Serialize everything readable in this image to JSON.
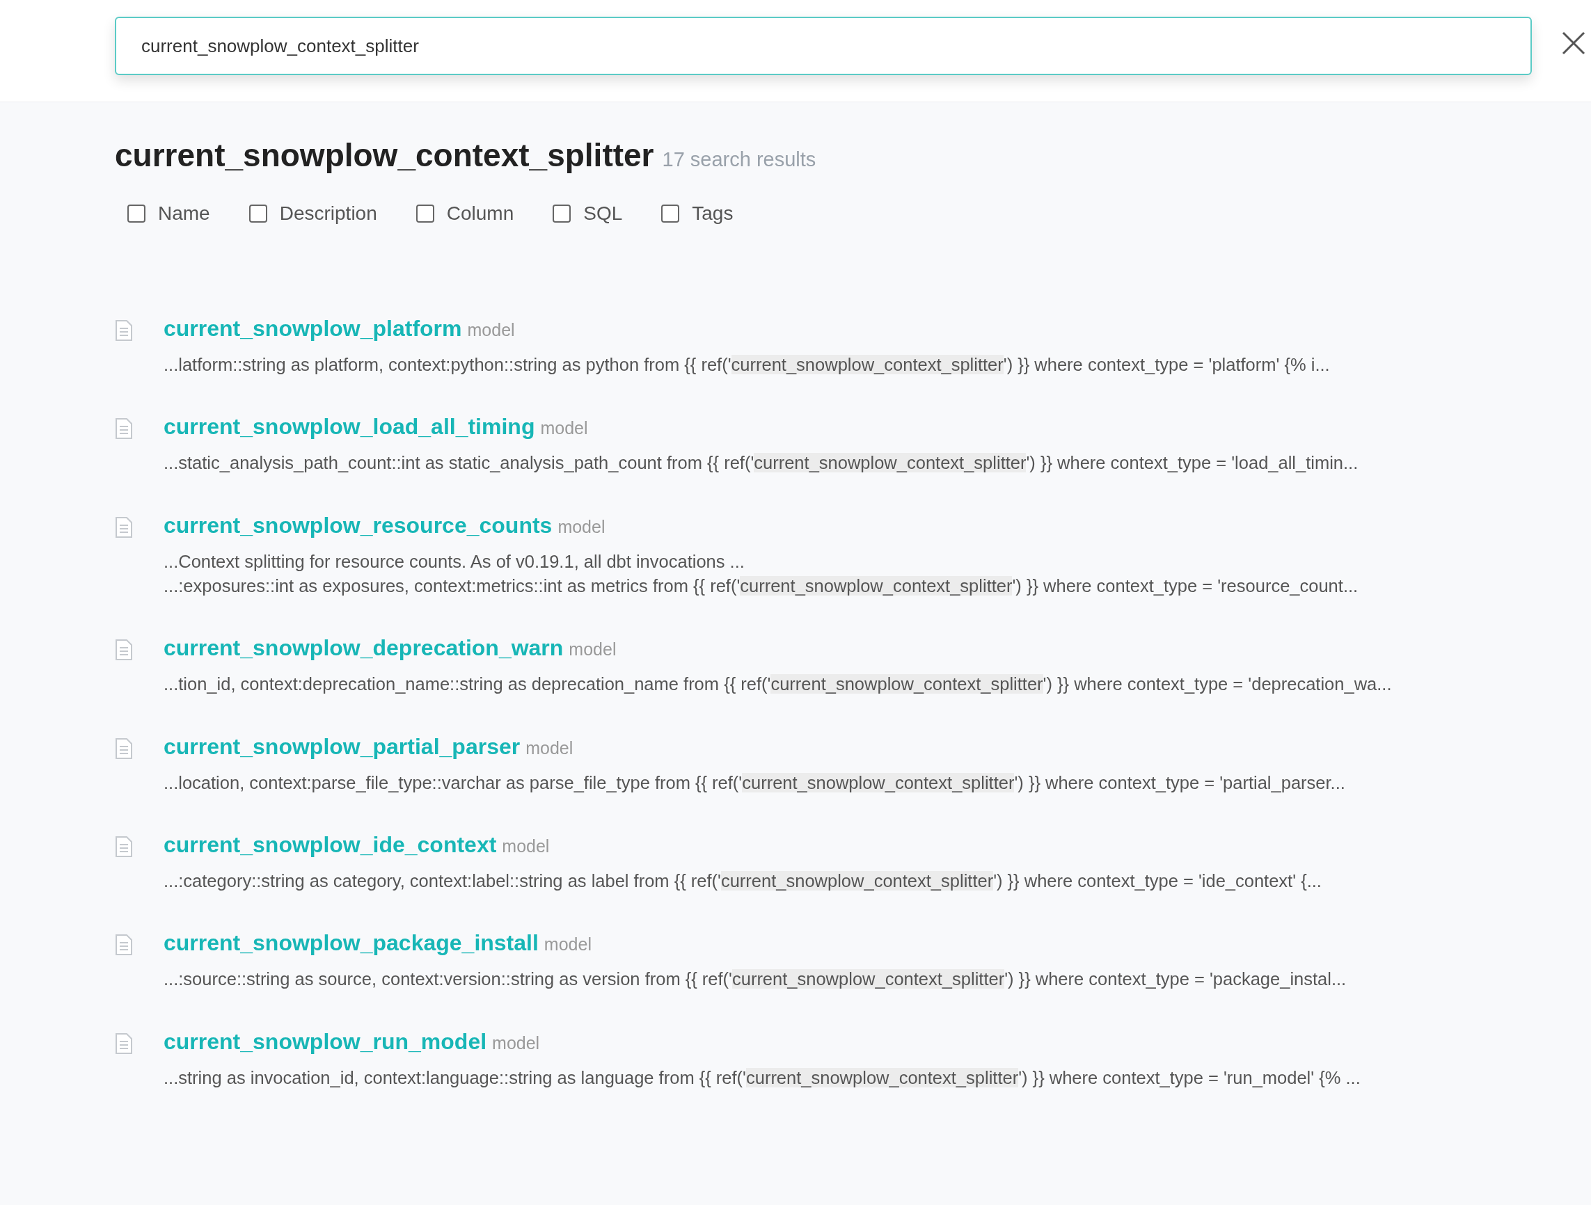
{
  "search": {
    "value": "current_snowplow_context_splitter"
  },
  "heading": {
    "query": "current_snowplow_context_splitter",
    "count": "17 search results"
  },
  "filters": [
    {
      "label": "Name",
      "checked": false
    },
    {
      "label": "Description",
      "checked": false
    },
    {
      "label": "Column",
      "checked": false
    },
    {
      "label": "SQL",
      "checked": false
    },
    {
      "label": "Tags",
      "checked": false
    }
  ],
  "results": [
    {
      "name": "current_snowplow_platform",
      "type": "model",
      "snippets": [
        {
          "before": "...latform::string as platform, context:python::string as python from {{ ref('",
          "match": "current_snowplow_context_splitter",
          "after": "') }} where context_type = 'platform' {% i..."
        }
      ]
    },
    {
      "name": "current_snowplow_load_all_timing",
      "type": "model",
      "snippets": [
        {
          "before": "...static_analysis_path_count::int as static_analysis_path_count from {{ ref('",
          "match": "current_snowplow_context_splitter",
          "after": "') }} where context_type = 'load_all_timin..."
        }
      ]
    },
    {
      "name": "current_snowplow_resource_counts",
      "type": "model",
      "snippets": [
        {
          "before": "...Context splitting for resource counts. As of v0.19.1, all dbt invocations ..."
        },
        {
          "before": "...:exposures::int as exposures, context:metrics::int as metrics from {{ ref('",
          "match": "current_snowplow_context_splitter",
          "after": "') }} where context_type = 'resource_count..."
        }
      ]
    },
    {
      "name": "current_snowplow_deprecation_warn",
      "type": "model",
      "snippets": [
        {
          "before": "...tion_id, context:deprecation_name::string as deprecation_name from {{ ref('",
          "match": "current_snowplow_context_splitter",
          "after": "') }} where context_type = 'deprecation_wa..."
        }
      ]
    },
    {
      "name": "current_snowplow_partial_parser",
      "type": "model",
      "snippets": [
        {
          "before": "...location, context:parse_file_type::varchar as parse_file_type from {{ ref('",
          "match": "current_snowplow_context_splitter",
          "after": "') }} where context_type = 'partial_parser..."
        }
      ]
    },
    {
      "name": "current_snowplow_ide_context",
      "type": "model",
      "snippets": [
        {
          "before": "...:category::string as category, context:label::string as label from {{ ref('",
          "match": "current_snowplow_context_splitter",
          "after": "') }} where context_type = 'ide_context' {..."
        }
      ]
    },
    {
      "name": "current_snowplow_package_install",
      "type": "model",
      "snippets": [
        {
          "before": "...:source::string as source, context:version::string as version from {{ ref('",
          "match": "current_snowplow_context_splitter",
          "after": "') }} where context_type = 'package_instal..."
        }
      ]
    },
    {
      "name": "current_snowplow_run_model",
      "type": "model",
      "snippets": [
        {
          "before": "...string as invocation_id, context:language::string as language from {{ ref('",
          "match": "current_snowplow_context_splitter",
          "after": "') }} where context_type = 'run_model' {% ..."
        }
      ]
    }
  ]
}
